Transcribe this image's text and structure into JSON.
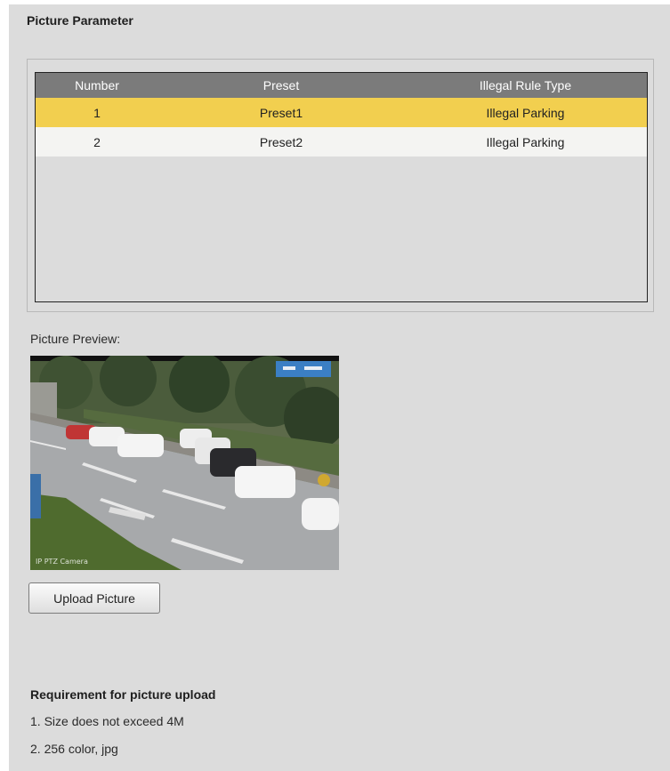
{
  "section": {
    "title": "Picture Parameter"
  },
  "table": {
    "headers": {
      "number": "Number",
      "preset": "Preset",
      "type": "Illegal Rule Type"
    },
    "rows": [
      {
        "number": "1",
        "preset": "Preset1",
        "type": "Illegal Parking"
      },
      {
        "number": "2",
        "preset": "Preset2",
        "type": "Illegal Parking"
      }
    ]
  },
  "preview": {
    "label": "Picture Preview:",
    "watermark": "IP PTZ Camera"
  },
  "upload": {
    "label": "Upload Picture"
  },
  "requirements": {
    "title": "Requirement for picture upload",
    "lines": [
      "1. Size does not exceed 4M",
      "2. 256 color, jpg"
    ]
  },
  "colors": {
    "selected_row": "#f2cf4f",
    "header_bg": "#7b7b7b",
    "panel_bg": "#dcdcdc"
  }
}
